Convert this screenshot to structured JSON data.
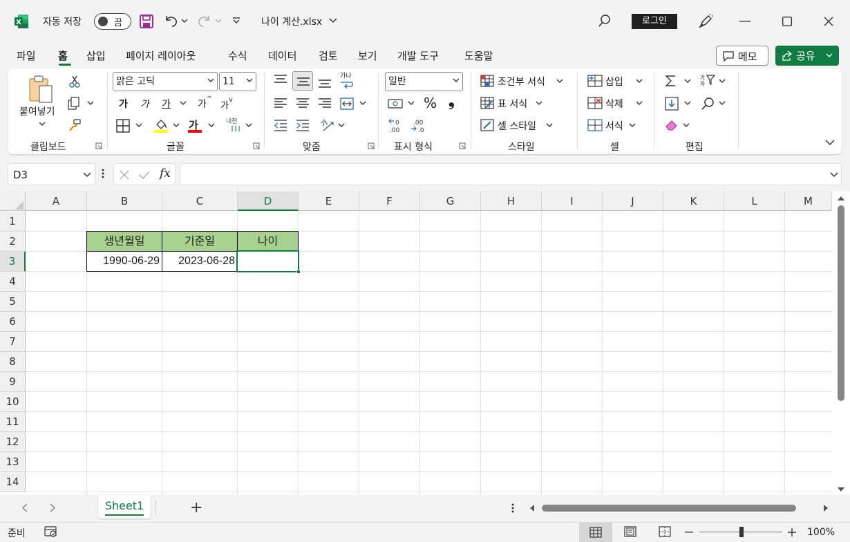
{
  "titlebar": {
    "autosave_label": "자동 저장",
    "autosave_state": "끔",
    "filename": "나이 계산.xlsx",
    "signin": "로그인"
  },
  "menu": {
    "tabs": [
      "파일",
      "홈",
      "삽입",
      "페이지 레이아웃",
      "수식",
      "데이터",
      "검토",
      "보기",
      "개발 도구",
      "도움말"
    ],
    "active_tab": "홈",
    "memo": "메모",
    "share": "공유"
  },
  "ribbon": {
    "clipboard": {
      "paste": "붙여넣기",
      "label": "클립보드"
    },
    "font": {
      "font_name": "맑은 고딕",
      "font_size": "11",
      "bold": "가",
      "italic": "가",
      "underline": "가",
      "grow": "가",
      "shrink": "가",
      "font_color_glyph": "가",
      "phonetic": "내천",
      "label": "글꼴"
    },
    "alignment": {
      "wrap_glyph": "가나",
      "orient_glyph": "가",
      "label": "맞춤"
    },
    "number": {
      "format": "일반",
      "percent": "%",
      "comma": "❟",
      "inc_dec": ".00",
      "label": "표시 형식"
    },
    "styles": {
      "conditional": "조건부 서식",
      "table": "표 서식",
      "cell": "셀 스타일",
      "label": "스타일"
    },
    "cells": {
      "insert": "삽입",
      "delete": "삭제",
      "format": "서식",
      "label": "셀"
    },
    "editing": {
      "label": "편집"
    }
  },
  "formula_bar": {
    "name_box": "D3",
    "fx": "fx",
    "content": ""
  },
  "grid": {
    "columns": [
      "A",
      "B",
      "C",
      "D",
      "E",
      "F",
      "G",
      "H",
      "I",
      "J",
      "K",
      "L",
      "M"
    ],
    "rows": [
      "1",
      "2",
      "3",
      "4",
      "5",
      "6",
      "7",
      "8",
      "9",
      "10",
      "11",
      "12",
      "13",
      "14"
    ],
    "selected_cell": "D3",
    "header_fill": "#A9D18E",
    "cells": {
      "B2": "생년월일",
      "C2": "기준일",
      "D2": "나이",
      "B3": "1990-06-29",
      "C3": "2023-06-28",
      "D3": ""
    }
  },
  "sheets": {
    "tabs": [
      "Sheet1"
    ],
    "active": "Sheet1",
    "add": "+"
  },
  "status": {
    "ready": "준비",
    "zoom": "100%",
    "zoom_level": 1.0
  },
  "colors": {
    "accent": "#107C41",
    "title_bg": "#F3F3F3"
  }
}
